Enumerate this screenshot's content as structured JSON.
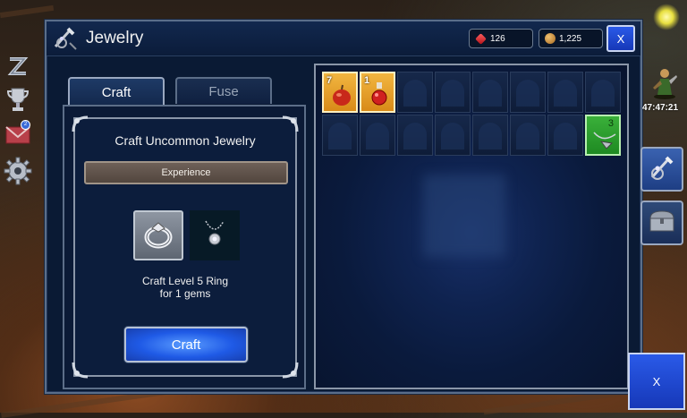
{
  "window": {
    "title": "Jewelry",
    "close_label": "X",
    "currencies": [
      {
        "icon": "ruby-gem-icon",
        "value": "126",
        "color": "#d8202a"
      },
      {
        "icon": "gold-coin-icon",
        "value": "1,225",
        "color": "#c8882a"
      }
    ]
  },
  "tabs": [
    {
      "label": "Craft",
      "active": true
    },
    {
      "label": "Fuse",
      "active": false
    }
  ],
  "craft": {
    "heading": "Craft Uncommon Jewelry",
    "category": "Experience",
    "slots": [
      {
        "icon": "silver-ring-icon",
        "selected": true
      },
      {
        "icon": "necklace-icon",
        "selected": false
      }
    ],
    "description_line1": "Craft Level 5 Ring",
    "description_line2": "for 1 gems",
    "button_label": "Craft"
  },
  "inventory": {
    "rows": 2,
    "columns": 8,
    "items": [
      {
        "row": 0,
        "col": 0,
        "icon": "red-apple-icon",
        "count": "7",
        "rarity": "gold"
      },
      {
        "row": 0,
        "col": 1,
        "icon": "red-potion-icon",
        "count": "1",
        "rarity": "gold"
      },
      {
        "row": 1,
        "col": 7,
        "icon": "green-amulet-icon",
        "count": "3",
        "rarity": "green"
      }
    ]
  },
  "hud": {
    "left_icons": [
      "zzz-icon",
      "trophy-icon",
      "mail-icon",
      "settings-gear-icon"
    ],
    "mail_badge": "2",
    "timer": "47:47:21",
    "side_buttons": [
      "jewelry-craft-icon",
      "treasure-chest-icon"
    ],
    "bottom_close_label": "X"
  },
  "colors": {
    "accent_blue": "#1f5ae6",
    "frame": "#8a96a8",
    "panel_bg": "#0b1a36",
    "gold": "#f2b640",
    "green": "#3ab03a"
  }
}
